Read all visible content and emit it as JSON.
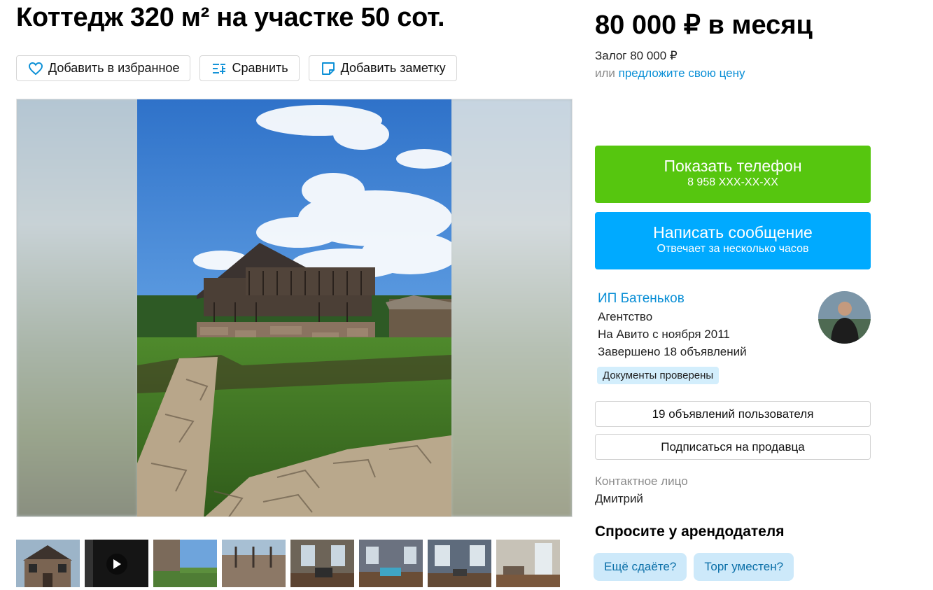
{
  "listing": {
    "title": "Коттедж 320 м² на участке 50 сот.",
    "actions": {
      "favorite_label": "Добавить в избранное",
      "compare_label": "Сравнить",
      "note_label": "Добавить заметку"
    }
  },
  "gallery": {
    "thumbnail_count": 8,
    "video_thumbnail_index": 1
  },
  "pricing": {
    "price": "80 000 ₽ в месяц",
    "deposit": "Залог 80 000 ₽",
    "offer_prefix": "или ",
    "offer_link": "предложите свою цену"
  },
  "contact_buttons": {
    "phone_title": "Показать телефон",
    "phone_number": "8 958 XXX-XX-XX",
    "message_title": "Написать сообщение",
    "message_subtitle": "Отвечает за несколько часов"
  },
  "seller": {
    "name": "ИП Батеньков",
    "type": "Агентство",
    "since": "На Авито с ноября 2011",
    "completed": "Завершено 18 объявлений",
    "verified_badge": "Документы проверены",
    "listings_button": "19 объявлений пользователя",
    "subscribe_button": "Подписаться на продавца"
  },
  "contact_person": {
    "label": "Контактное лицо",
    "name": "Дмитрий"
  },
  "ask": {
    "title": "Спросите у арендодателя",
    "chips": [
      "Ещё сдаёте?",
      "Торг уместен?"
    ]
  },
  "colors": {
    "green": "#56c60f",
    "blue": "#00aaff",
    "link": "#0a8fd6",
    "chip_bg": "#cde9fa"
  }
}
